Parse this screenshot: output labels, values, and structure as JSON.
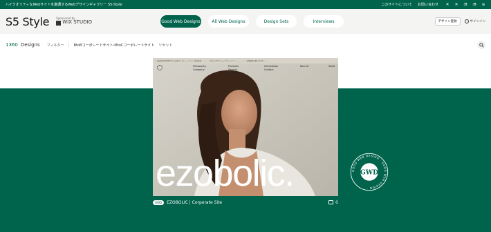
{
  "topbar": {
    "tagline": "ハイクオリティなWebサイトを厳選するWebデザインギャラリー S5-Style",
    "links": [
      "このサイトについて",
      "お問い合わせ"
    ],
    "social_icons": [
      "x-icon",
      "x-icon-2",
      "rss-icon",
      "rss-icon-2",
      "feed-icon"
    ]
  },
  "header": {
    "logo": "S5 Style",
    "sponsor_label": "Sponsored by",
    "sponsor_name": "WIX STUDIO",
    "nav": [
      "Good Web Designs",
      "All Web Designs",
      "Design Sets",
      "Interviews"
    ],
    "active_nav": "Good Web Designs",
    "register_label": "デザイン登録",
    "signin_label": "サインイン"
  },
  "filterbar": {
    "count": "1360",
    "count_label": "Designs",
    "filter_label": "フィルター",
    "tag": "BtoBコーポレートサイト•BtoCコーポレートサイト",
    "reset_label": "リセット"
  },
  "card": {
    "topline": "ー 株式会社EZOBOLICの公式コーポレートサイト 北海道発 — ……… スカルプケア ピュアラインドラ ……… ……… 会場概要お問い合わせ ……",
    "nav_items": [
      {
        "lines": [
          "Philosophy",
          "Company"
        ]
      },
      {
        "lines": [
          "Products",
          "Second",
          "Laboratory"
        ]
      },
      {
        "lines": [
          "Information",
          "Contact"
        ]
      },
      {
        "lines": [
          "Recruit"
        ]
      },
      {
        "lines": [
          "Store"
        ]
      }
    ],
    "hero_text": "ezobolic.",
    "badge": "GWD",
    "caption": "EZOBOLIC | Corporate Site",
    "fav_count": "0"
  },
  "seal": {
    "ring_text": "GOOD WEB DESIGN · GOOD WEB DESIGN ·",
    "center": "GWD"
  },
  "colors": {
    "brand": "#00634c",
    "header_bg": "#f4f4f2"
  }
}
